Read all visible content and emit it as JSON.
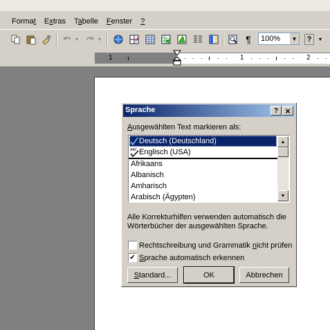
{
  "menubar": {
    "items": [
      {
        "label": "Format",
        "pre": "Forma",
        "u": "t",
        "post": ""
      },
      {
        "label": "Extras",
        "pre": "E",
        "u": "x",
        "post": "tras"
      },
      {
        "label": "Tabelle",
        "pre": "T",
        "u": "a",
        "post": "belle"
      },
      {
        "label": "Fenster",
        "pre": "",
        "u": "F",
        "post": "enster"
      },
      {
        "label": "?",
        "pre": "",
        "u": "?",
        "post": ""
      }
    ]
  },
  "toolbar": {
    "zoom": "100%",
    "paragraph_glyph": "¶",
    "help_glyph": "?"
  },
  "ruler": {
    "numbers": [
      "1",
      "1",
      "2"
    ]
  },
  "dialog": {
    "title": "Sprache",
    "help_glyph": "?",
    "close_glyph": "×",
    "list_label_underlined": "A",
    "list_label_rest": "usgewählten Text markieren als:",
    "languages": [
      "Deutsch (Deutschland)",
      "Englisch (USA)",
      "Afrikaans",
      "Albanisch",
      "Amharisch",
      "Arabisch (Ägypten)"
    ],
    "info_line1": "Alle Korrekturhilfen verwenden automatisch die",
    "info_line2": "Wörterbücher der ausgewählten Sprache.",
    "check1": {
      "pre": "Rechtschreibung und Grammatik ",
      "u": "n",
      "post": "icht prüfen",
      "checked": false
    },
    "check2": {
      "pre": "",
      "u": "S",
      "post": "prache automatisch erkennen",
      "checked": true
    },
    "buttons": {
      "standard_pre": "",
      "standard_u": "S",
      "standard_post": "tandard...",
      "ok": "OK",
      "cancel": "Abbrechen"
    }
  },
  "colors": {
    "titlebar_start": "#0a246a",
    "titlebar_end": "#a6caf0",
    "selection": "#0a246a",
    "face": "#d4d0c8"
  }
}
